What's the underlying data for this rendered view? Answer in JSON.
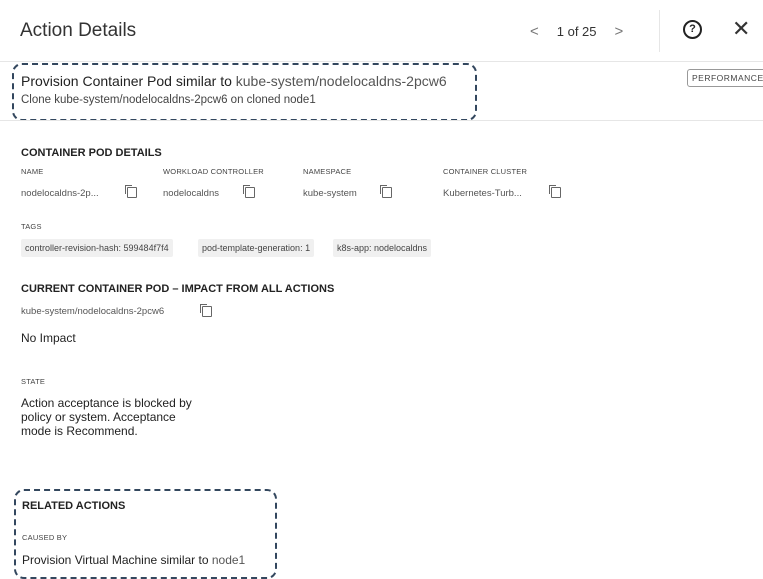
{
  "header": {
    "title": "Action Details",
    "pager": {
      "prev": "<",
      "count": "1 of 25",
      "next": ">"
    },
    "help_glyph": "?",
    "close_glyph": "✕"
  },
  "action": {
    "title_prefix": "Provision Container Pod similar to ",
    "title_link": "kube-system/nodelocaldns-2pcw6",
    "subtitle": "Clone kube-system/nodelocaldns-2pcw6 on cloned node1",
    "badge": "PERFORMANCE"
  },
  "pod_details": {
    "heading": "CONTAINER POD DETAILS",
    "fields": [
      {
        "label": "NAME",
        "value": "nodelocaldns-2p..."
      },
      {
        "label": "WORKLOAD CONTROLLER",
        "value": "nodelocaldns"
      },
      {
        "label": "NAMESPACE",
        "value": "kube-system"
      },
      {
        "label": "CONTAINER CLUSTER",
        "value": "Kubernetes-Turb..."
      }
    ],
    "tags_label": "TAGS",
    "tags": [
      "controller-revision-hash: 599484f7f4",
      "pod-template-generation: 1",
      "k8s-app: nodelocaldns"
    ]
  },
  "impact": {
    "heading": "CURRENT CONTAINER POD – IMPACT FROM ALL ACTIONS",
    "entity": "kube-system/nodelocaldns-2pcw6",
    "summary": "No Impact"
  },
  "state": {
    "label": "STATE",
    "text": "Action acceptance is blocked by policy or system. Acceptance mode is Recommend."
  },
  "related": {
    "heading": "RELATED ACTIONS",
    "caused_by_label": "CAUSED BY",
    "caused_by_prefix": "Provision Virtual Machine similar to ",
    "caused_by_link": "node1"
  }
}
